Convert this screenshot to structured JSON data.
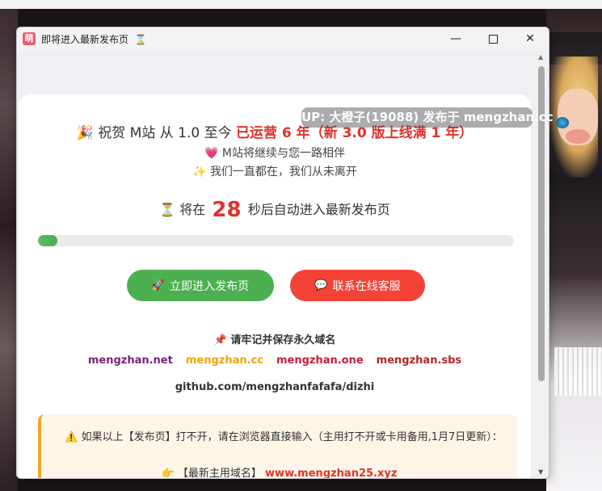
{
  "window": {
    "title": "即将进入最新发布页",
    "title_icon": "hourglass-icon",
    "app_icon_text": "萌"
  },
  "celebrate": {
    "prefix": "祝贺 M站 从 1.0 至今",
    "highlight": "已运营 6 年（新 3.0 版上线满 1 年）",
    "line2": "M站将继续与您一路相伴",
    "line3": "我们一直都在，我们从未离开"
  },
  "countdown": {
    "before": "将在",
    "seconds": "28",
    "after": "秒后自动进入最新发布页",
    "progress_percent": 4
  },
  "buttons": {
    "enter": "立即进入发布页",
    "support": "联系在线客服"
  },
  "domains": {
    "title": "请牢记并保存永久域名",
    "list": [
      "mengzhan.net",
      "mengzhan.cc",
      "mengzhan.one",
      "mengzhan.sbs"
    ],
    "github": "github.com/mengzhanfafafa/dizhi"
  },
  "notice": {
    "text": "如果以上【发布页】打不开，请在浏览器直接输入（主用打不开或卡用备用,1月7日更新）：",
    "label": "【最新主用域名】",
    "link": "www.mengzhan25.xyz"
  },
  "watermark": "UP: 大橙子(19088) 发布于 mengzhan.cc",
  "colors": {
    "accent_red": "#e0322a",
    "green": "#4caf50",
    "red": "#f44336",
    "notice_border": "#f5a623"
  }
}
